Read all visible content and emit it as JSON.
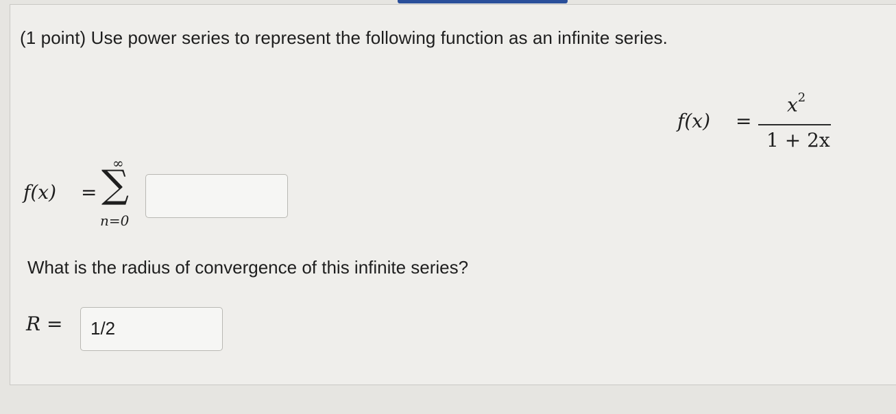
{
  "question": {
    "text": "(1 point) Use power series to represent the following function as an infinite series."
  },
  "function_def": {
    "lhs": "f(x)",
    "equals": "=",
    "numerator_base": "x",
    "numerator_exp": "2",
    "denominator": "1 + 2x"
  },
  "series": {
    "lhs": "f(x)",
    "equals": "=",
    "upper_limit": "∞",
    "sigma": "∑",
    "lower_limit": "n=0",
    "answer_value": ""
  },
  "radius": {
    "question": "What is the radius of convergence of this infinite series?",
    "label": "R =",
    "value": "1/2"
  },
  "colors": {
    "page_background": "#e6e5e1",
    "panel_background": "#efeeeb",
    "top_bar": "#2a4f9a"
  }
}
